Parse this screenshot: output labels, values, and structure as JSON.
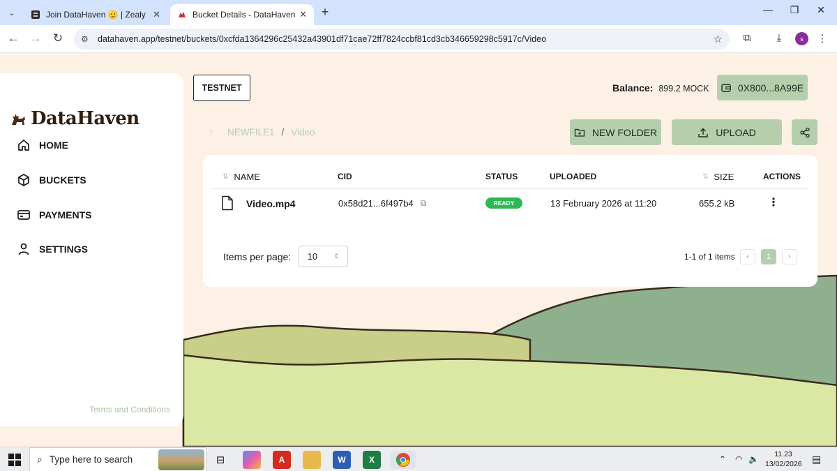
{
  "browser": {
    "tabs": [
      {
        "title": "Join DataHaven 🫡 | Zealy",
        "active": false
      },
      {
        "title": "Bucket Details - DataHaven App",
        "active": true
      }
    ],
    "url": "datahaven.app/testnet/buckets/0xcfda1364296c25432a43901df71cae72ff7824ccbf81cd3cb346659298c5917c/Video",
    "profile_initial": "s"
  },
  "sidebar": {
    "brand": "DataHaven",
    "items": [
      {
        "label": "HOME",
        "icon": "home-icon"
      },
      {
        "label": "BUCKETS",
        "icon": "cube-icon"
      },
      {
        "label": "PAYMENTS",
        "icon": "card-icon"
      },
      {
        "label": "SETTINGS",
        "icon": "user-icon"
      }
    ],
    "terms": "Terms and Conditions"
  },
  "header": {
    "network": "TESTNET",
    "balance_label": "Balance:",
    "balance_value": "899.2 MOCK",
    "wallet": "0X800...8A99E"
  },
  "breadcrumb": {
    "parent": "NEWFILE1",
    "separator": "/",
    "current": "Video"
  },
  "actions": {
    "new_folder": "NEW FOLDER",
    "upload": "UPLOAD"
  },
  "table": {
    "columns": [
      "NAME",
      "CID",
      "STATUS",
      "UPLOADED",
      "SIZE",
      "ACTIONS"
    ],
    "rows": [
      {
        "name": "Video.mp4",
        "cid": "0x58d21...6f497b4",
        "status": "READY",
        "uploaded": "13 February 2026 at 11:20",
        "size": "655.2 kB"
      }
    ]
  },
  "pagination": {
    "items_per_page_label": "Items per page:",
    "items_per_page_value": "10",
    "range": "1-1 of 1 items",
    "prev": "‹",
    "current_page": "1",
    "next": "›"
  },
  "taskbar": {
    "search_placeholder": "Type here to search",
    "time": "11.23",
    "date": "13/02/2026"
  },
  "colors": {
    "accent_green": "#b5cfad",
    "status_ready": "#2cb954",
    "page_bg": "#fdf1e6"
  }
}
